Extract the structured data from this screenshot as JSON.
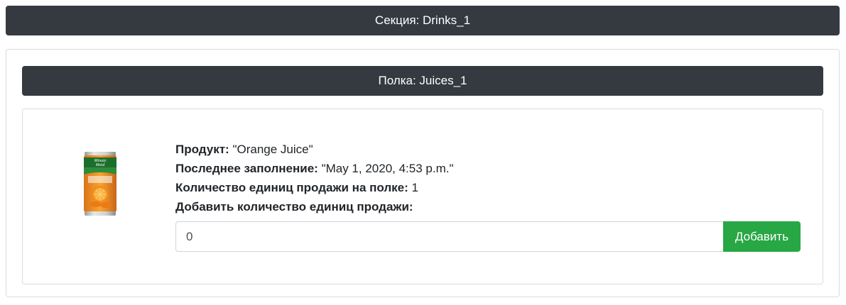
{
  "section": {
    "title": "Секция: Drinks_1"
  },
  "shelf": {
    "title": "Полка: Juices_1"
  },
  "product": {
    "image_label": "Minute Maid",
    "name_label": "Продукт:",
    "name_value": "\"Orange Juice\"",
    "last_refill_label": "Последнее заполнение:",
    "last_refill_value": "\"May 1, 2020, 4:53 p.m.\"",
    "units_on_shelf_label": "Количество единиц продажи на полке:",
    "units_on_shelf_value": "1",
    "add_units_label": "Добавить количество единиц продажи:"
  },
  "form": {
    "quantity_value": "0",
    "add_button_label": "Добавить"
  },
  "colors": {
    "header_bg": "#343a40",
    "button_green": "#28a745"
  }
}
